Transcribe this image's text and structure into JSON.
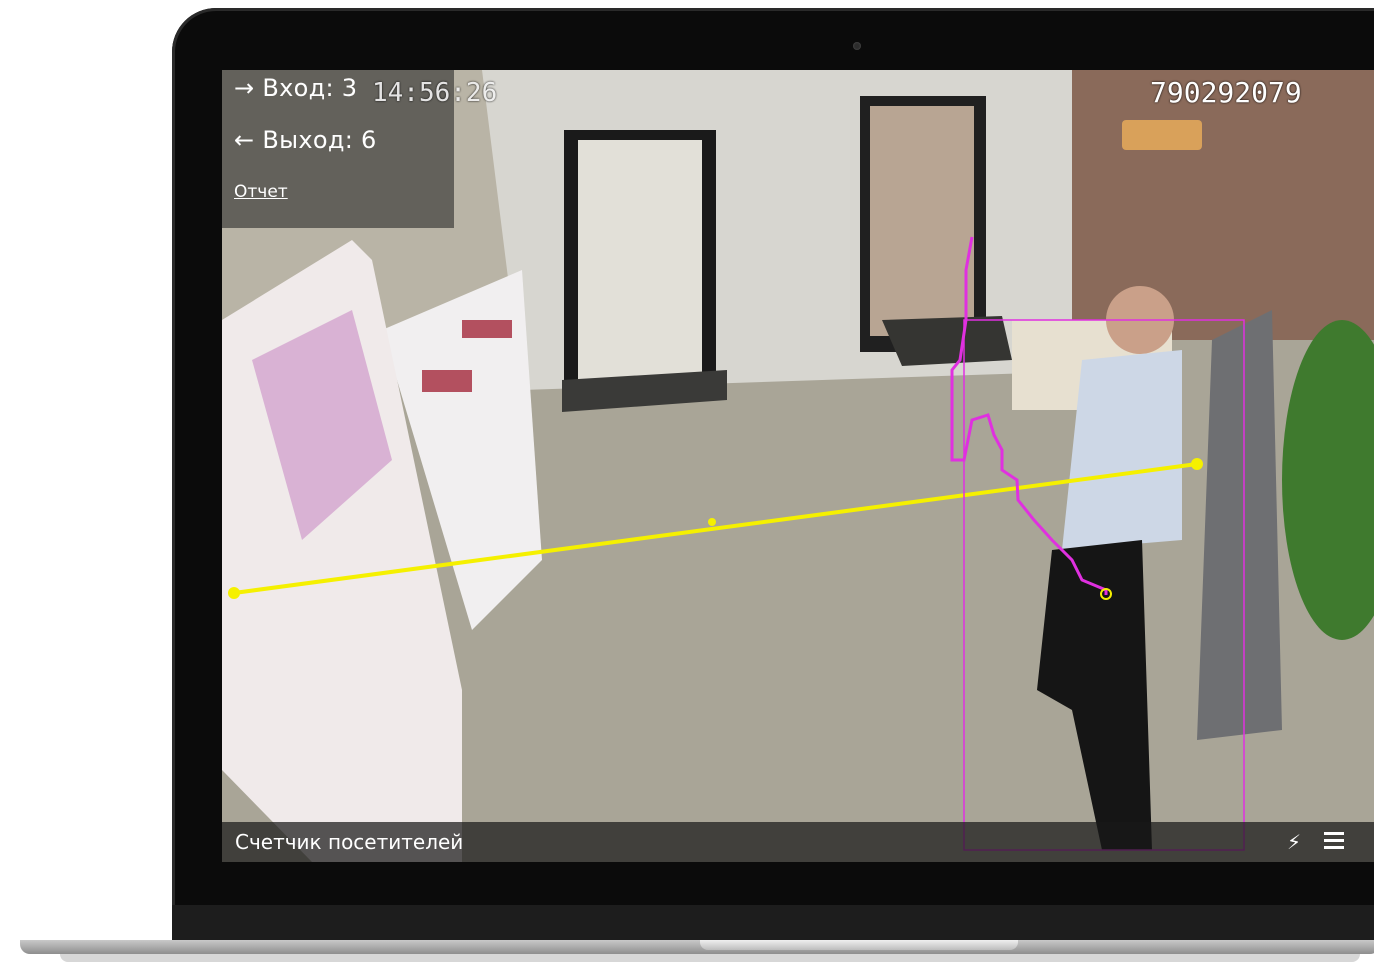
{
  "camera": {
    "entry_label": "→ Вход: 3",
    "exit_label": "← Выход: 6",
    "report_link": "Отчет",
    "timestamp": "14:56:26",
    "camera_id": "790292079",
    "title": "Счетчик посетителей"
  },
  "toolbar": {
    "flash_icon": "lightning-icon",
    "menu_icon": "hamburger-menu-icon"
  },
  "colors": {
    "counting_line": "#f5f000",
    "track": "#e030e0"
  }
}
